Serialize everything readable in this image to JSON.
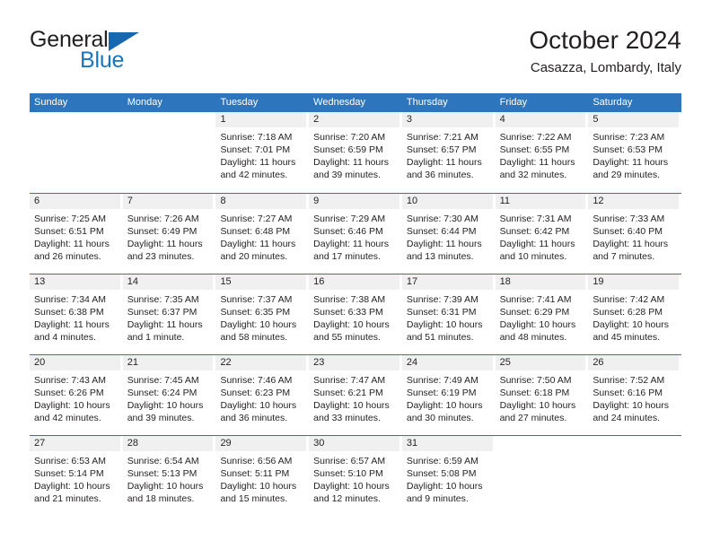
{
  "brand": {
    "word_one": "General",
    "word_two": "Blue",
    "triangle_color": "#1868b0",
    "blue_text_color": "#1577c4"
  },
  "header": {
    "title": "October 2024",
    "subtitle": "Casazza, Lombardy, Italy",
    "accent_color": "#2d76bd",
    "band_color": "#f0f0f0"
  },
  "weekdays": [
    "Sunday",
    "Monday",
    "Tuesday",
    "Wednesday",
    "Thursday",
    "Friday",
    "Saturday"
  ],
  "weeks": [
    [
      {
        "day": "",
        "sunrise": "",
        "sunset": "",
        "daylight_1": "",
        "daylight_2": "",
        "blank": true
      },
      {
        "day": "",
        "sunrise": "",
        "sunset": "",
        "daylight_1": "",
        "daylight_2": "",
        "blank": true
      },
      {
        "day": "1",
        "sunrise": "Sunrise: 7:18 AM",
        "sunset": "Sunset: 7:01 PM",
        "daylight_1": "Daylight: 11 hours",
        "daylight_2": "and 42 minutes."
      },
      {
        "day": "2",
        "sunrise": "Sunrise: 7:20 AM",
        "sunset": "Sunset: 6:59 PM",
        "daylight_1": "Daylight: 11 hours",
        "daylight_2": "and 39 minutes."
      },
      {
        "day": "3",
        "sunrise": "Sunrise: 7:21 AM",
        "sunset": "Sunset: 6:57 PM",
        "daylight_1": "Daylight: 11 hours",
        "daylight_2": "and 36 minutes."
      },
      {
        "day": "4",
        "sunrise": "Sunrise: 7:22 AM",
        "sunset": "Sunset: 6:55 PM",
        "daylight_1": "Daylight: 11 hours",
        "daylight_2": "and 32 minutes."
      },
      {
        "day": "5",
        "sunrise": "Sunrise: 7:23 AM",
        "sunset": "Sunset: 6:53 PM",
        "daylight_1": "Daylight: 11 hours",
        "daylight_2": "and 29 minutes."
      }
    ],
    [
      {
        "day": "6",
        "sunrise": "Sunrise: 7:25 AM",
        "sunset": "Sunset: 6:51 PM",
        "daylight_1": "Daylight: 11 hours",
        "daylight_2": "and 26 minutes."
      },
      {
        "day": "7",
        "sunrise": "Sunrise: 7:26 AM",
        "sunset": "Sunset: 6:49 PM",
        "daylight_1": "Daylight: 11 hours",
        "daylight_2": "and 23 minutes."
      },
      {
        "day": "8",
        "sunrise": "Sunrise: 7:27 AM",
        "sunset": "Sunset: 6:48 PM",
        "daylight_1": "Daylight: 11 hours",
        "daylight_2": "and 20 minutes."
      },
      {
        "day": "9",
        "sunrise": "Sunrise: 7:29 AM",
        "sunset": "Sunset: 6:46 PM",
        "daylight_1": "Daylight: 11 hours",
        "daylight_2": "and 17 minutes."
      },
      {
        "day": "10",
        "sunrise": "Sunrise: 7:30 AM",
        "sunset": "Sunset: 6:44 PM",
        "daylight_1": "Daylight: 11 hours",
        "daylight_2": "and 13 minutes."
      },
      {
        "day": "11",
        "sunrise": "Sunrise: 7:31 AM",
        "sunset": "Sunset: 6:42 PM",
        "daylight_1": "Daylight: 11 hours",
        "daylight_2": "and 10 minutes."
      },
      {
        "day": "12",
        "sunrise": "Sunrise: 7:33 AM",
        "sunset": "Sunset: 6:40 PM",
        "daylight_1": "Daylight: 11 hours",
        "daylight_2": "and 7 minutes."
      }
    ],
    [
      {
        "day": "13",
        "sunrise": "Sunrise: 7:34 AM",
        "sunset": "Sunset: 6:38 PM",
        "daylight_1": "Daylight: 11 hours",
        "daylight_2": "and 4 minutes."
      },
      {
        "day": "14",
        "sunrise": "Sunrise: 7:35 AM",
        "sunset": "Sunset: 6:37 PM",
        "daylight_1": "Daylight: 11 hours",
        "daylight_2": "and 1 minute."
      },
      {
        "day": "15",
        "sunrise": "Sunrise: 7:37 AM",
        "sunset": "Sunset: 6:35 PM",
        "daylight_1": "Daylight: 10 hours",
        "daylight_2": "and 58 minutes."
      },
      {
        "day": "16",
        "sunrise": "Sunrise: 7:38 AM",
        "sunset": "Sunset: 6:33 PM",
        "daylight_1": "Daylight: 10 hours",
        "daylight_2": "and 55 minutes."
      },
      {
        "day": "17",
        "sunrise": "Sunrise: 7:39 AM",
        "sunset": "Sunset: 6:31 PM",
        "daylight_1": "Daylight: 10 hours",
        "daylight_2": "and 51 minutes."
      },
      {
        "day": "18",
        "sunrise": "Sunrise: 7:41 AM",
        "sunset": "Sunset: 6:29 PM",
        "daylight_1": "Daylight: 10 hours",
        "daylight_2": "and 48 minutes."
      },
      {
        "day": "19",
        "sunrise": "Sunrise: 7:42 AM",
        "sunset": "Sunset: 6:28 PM",
        "daylight_1": "Daylight: 10 hours",
        "daylight_2": "and 45 minutes."
      }
    ],
    [
      {
        "day": "20",
        "sunrise": "Sunrise: 7:43 AM",
        "sunset": "Sunset: 6:26 PM",
        "daylight_1": "Daylight: 10 hours",
        "daylight_2": "and 42 minutes."
      },
      {
        "day": "21",
        "sunrise": "Sunrise: 7:45 AM",
        "sunset": "Sunset: 6:24 PM",
        "daylight_1": "Daylight: 10 hours",
        "daylight_2": "and 39 minutes."
      },
      {
        "day": "22",
        "sunrise": "Sunrise: 7:46 AM",
        "sunset": "Sunset: 6:23 PM",
        "daylight_1": "Daylight: 10 hours",
        "daylight_2": "and 36 minutes."
      },
      {
        "day": "23",
        "sunrise": "Sunrise: 7:47 AM",
        "sunset": "Sunset: 6:21 PM",
        "daylight_1": "Daylight: 10 hours",
        "daylight_2": "and 33 minutes."
      },
      {
        "day": "24",
        "sunrise": "Sunrise: 7:49 AM",
        "sunset": "Sunset: 6:19 PM",
        "daylight_1": "Daylight: 10 hours",
        "daylight_2": "and 30 minutes."
      },
      {
        "day": "25",
        "sunrise": "Sunrise: 7:50 AM",
        "sunset": "Sunset: 6:18 PM",
        "daylight_1": "Daylight: 10 hours",
        "daylight_2": "and 27 minutes."
      },
      {
        "day": "26",
        "sunrise": "Sunrise: 7:52 AM",
        "sunset": "Sunset: 6:16 PM",
        "daylight_1": "Daylight: 10 hours",
        "daylight_2": "and 24 minutes."
      }
    ],
    [
      {
        "day": "27",
        "sunrise": "Sunrise: 6:53 AM",
        "sunset": "Sunset: 5:14 PM",
        "daylight_1": "Daylight: 10 hours",
        "daylight_2": "and 21 minutes."
      },
      {
        "day": "28",
        "sunrise": "Sunrise: 6:54 AM",
        "sunset": "Sunset: 5:13 PM",
        "daylight_1": "Daylight: 10 hours",
        "daylight_2": "and 18 minutes."
      },
      {
        "day": "29",
        "sunrise": "Sunrise: 6:56 AM",
        "sunset": "Sunset: 5:11 PM",
        "daylight_1": "Daylight: 10 hours",
        "daylight_2": "and 15 minutes."
      },
      {
        "day": "30",
        "sunrise": "Sunrise: 6:57 AM",
        "sunset": "Sunset: 5:10 PM",
        "daylight_1": "Daylight: 10 hours",
        "daylight_2": "and 12 minutes."
      },
      {
        "day": "31",
        "sunrise": "Sunrise: 6:59 AM",
        "sunset": "Sunset: 5:08 PM",
        "daylight_1": "Daylight: 10 hours",
        "daylight_2": "and 9 minutes."
      },
      {
        "day": "",
        "sunrise": "",
        "sunset": "",
        "daylight_1": "",
        "daylight_2": "",
        "blank": true
      },
      {
        "day": "",
        "sunrise": "",
        "sunset": "",
        "daylight_1": "",
        "daylight_2": "",
        "blank": true
      }
    ]
  ]
}
